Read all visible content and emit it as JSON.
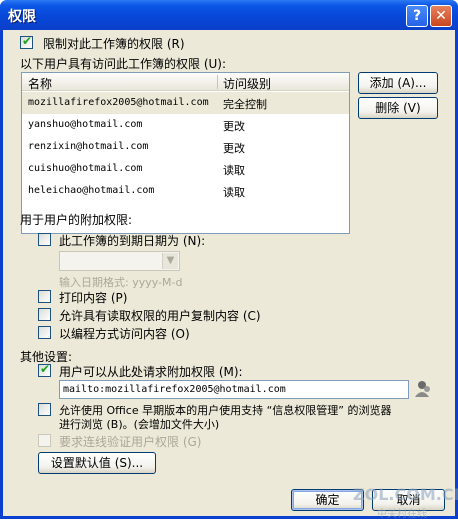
{
  "window": {
    "title": "权限"
  },
  "restrict": {
    "label": "限制对此工作簿的权限 (R)",
    "checked": true
  },
  "users_section": {
    "label": "以下用户具有访问此工作簿的权限 (U):",
    "columns": [
      "名称",
      "访问级别"
    ],
    "rows": [
      {
        "name": "mozillafirefox2005@hotmail.com",
        "level": "完全控制"
      },
      {
        "name": "yanshuo@hotmail.com",
        "level": "更改"
      },
      {
        "name": "renzixin@hotmail.com",
        "level": "更改"
      },
      {
        "name": "cuishuo@hotmail.com",
        "level": "读取"
      },
      {
        "name": "heleichao@hotmail.com",
        "level": "读取"
      }
    ],
    "add_button": "添加 (A)...",
    "remove_button": "删除 (V)"
  },
  "additional": {
    "label": "用于用户的附加权限:",
    "expire": {
      "label": "此工作簿的到期日期为 (N):",
      "checked": false
    },
    "date_hint": "输入日期格式: yyyy-M-d",
    "print": {
      "label": "打印内容 (P)",
      "checked": false
    },
    "copy": {
      "label": "允许具有读取权限的用户复制内容 (C)",
      "checked": false
    },
    "programmatic": {
      "label": "以编程方式访问内容 (O)",
      "checked": false
    }
  },
  "other": {
    "label": "其他设置:",
    "request": {
      "label": "用户可以从此处请求附加权限 (M):",
      "checked": true
    },
    "request_value": "mailto:mozillafirefox2005@hotmail.com",
    "older_office": {
      "label_line1": "允许使用 Office 早期版本的用户使用支持 “信息权限管理” 的浏览器",
      "label_line2": "进行浏览 (B)。(会增加文件大小)",
      "checked": false
    },
    "verify": {
      "label": "要求连线验证用户权限 (G)",
      "checked": false
    },
    "defaults_button": "设置默认值 (S)..."
  },
  "footer": {
    "ok": "确定",
    "cancel": "取消"
  },
  "watermark": {
    "text": "ZOL.COM.CN",
    "subtext": "中关村在线"
  },
  "colors": {
    "titlebar": "#0a4be0",
    "face": "#ece9d8",
    "check": "#21a121"
  },
  "icons": [
    "help-icon",
    "close-icon",
    "address-book-icon",
    "dropdown-arrow-icon"
  ]
}
